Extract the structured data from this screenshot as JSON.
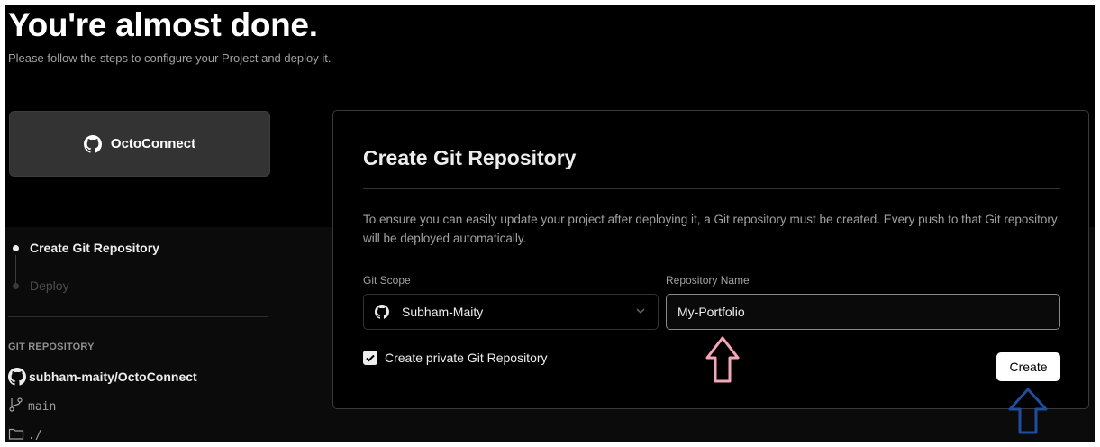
{
  "header": {
    "title": "You're almost done.",
    "subtitle": "Please follow the steps to configure your Project and deploy it."
  },
  "project": {
    "name": "OctoConnect",
    "icon": "github-icon"
  },
  "steps": [
    {
      "label": "Create Git Repository",
      "state": "active"
    },
    {
      "label": "Deploy",
      "state": "pending"
    }
  ],
  "git_info": {
    "heading": "GIT REPOSITORY",
    "repo": "subham-maity/OctoConnect",
    "branch": "main",
    "directory": "./"
  },
  "panel": {
    "title": "Create Git Repository",
    "description": "To ensure you can easily update your project after deploying it, a Git repository must be created. Every push to that Git repository will be deployed automatically.",
    "scope_label": "Git Scope",
    "scope_value": "Subham-Maity",
    "name_label": "Repository Name",
    "name_value": "My-Portfolio",
    "private_label": "Create private Git Repository",
    "private_checked": true,
    "create_label": "Create"
  },
  "annotations": {
    "pink_arrow_color": "#f4a6b8",
    "blue_arrow_color": "#1f4e9e"
  },
  "colors": {
    "background": "#000000",
    "text_primary": "#ededed",
    "text_secondary": "#a1a1a1",
    "border": "#333333"
  }
}
